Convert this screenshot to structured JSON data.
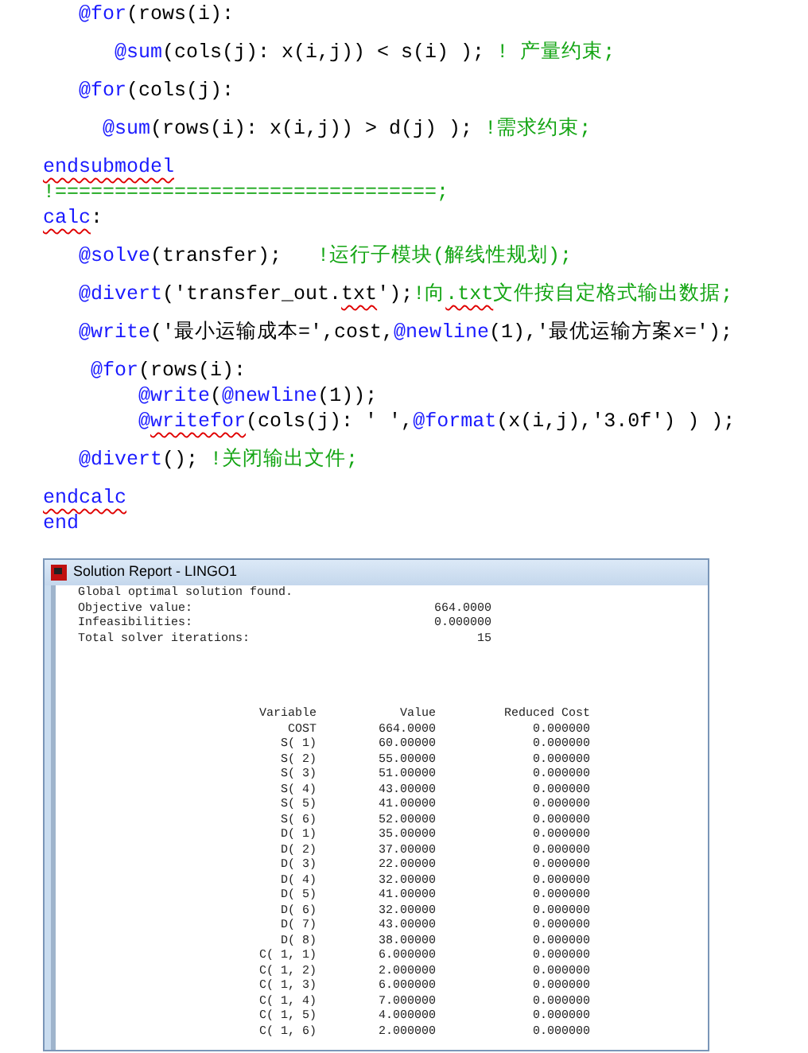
{
  "code_blocks": [
    [
      {
        "segments": [
          {
            "kind": "func",
            "text": "   @for",
            "misspelled": false
          },
          {
            "kind": "plain",
            "text": "(rows(i):",
            "misspelled": false
          }
        ]
      }
    ],
    [
      {
        "segments": [
          {
            "kind": "func",
            "text": "      @sum",
            "misspelled": false
          },
          {
            "kind": "plain",
            "text": "(cols(j): x(i,j)) < s(i) ); ",
            "misspelled": false
          },
          {
            "kind": "comment",
            "text": "! 产量约束;",
            "misspelled": false
          }
        ]
      }
    ],
    [
      {
        "segments": [
          {
            "kind": "func",
            "text": "   @for",
            "misspelled": false
          },
          {
            "kind": "plain",
            "text": "(cols(j):",
            "misspelled": false
          }
        ]
      }
    ],
    [
      {
        "segments": [
          {
            "kind": "func",
            "text": "     @sum",
            "misspelled": false
          },
          {
            "kind": "plain",
            "text": "(rows(i): x(i,j)) > d(j) ); ",
            "misspelled": false
          },
          {
            "kind": "comment",
            "text": "!需求约束;",
            "misspelled": false
          }
        ]
      }
    ],
    [
      {
        "segments": [
          {
            "kind": "func",
            "text": "endsubmodel",
            "misspelled": true
          }
        ]
      },
      {
        "segments": [
          {
            "kind": "comment",
            "text": "!================================;",
            "misspelled": false
          }
        ]
      },
      {
        "segments": [
          {
            "kind": "func",
            "text": "calc",
            "misspelled": true
          },
          {
            "kind": "plain",
            "text": ":",
            "misspelled": false
          }
        ]
      }
    ],
    [
      {
        "segments": [
          {
            "kind": "func",
            "text": "   @solve",
            "misspelled": false
          },
          {
            "kind": "plain",
            "text": "(transfer);   ",
            "misspelled": false
          },
          {
            "kind": "comment",
            "text": "!运行子模块(解线性规划);",
            "misspelled": false
          }
        ]
      }
    ],
    [
      {
        "segments": [
          {
            "kind": "func",
            "text": "   @divert",
            "misspelled": false
          },
          {
            "kind": "plain",
            "text": "('transfer_out.",
            "misspelled": false
          },
          {
            "kind": "plain",
            "text": "txt",
            "misspelled": true
          },
          {
            "kind": "plain",
            "text": "');",
            "misspelled": false
          },
          {
            "kind": "comment",
            "text": "!向",
            "misspelled": false
          },
          {
            "kind": "comment",
            "text": ".txt",
            "misspelled": true
          },
          {
            "kind": "comment",
            "text": "文件按自定格式输出数据;",
            "misspelled": false
          }
        ]
      }
    ],
    [
      {
        "segments": [
          {
            "kind": "func",
            "text": "   @write",
            "misspelled": false
          },
          {
            "kind": "plain",
            "text": "('最小运输成本=',cost,",
            "misspelled": false
          },
          {
            "kind": "func",
            "text": "@newline",
            "misspelled": false
          },
          {
            "kind": "plain",
            "text": "(1),'最优运输方案x=');",
            "misspelled": false
          }
        ]
      }
    ],
    [
      {
        "segments": [
          {
            "kind": "func",
            "text": "    @for",
            "misspelled": false
          },
          {
            "kind": "plain",
            "text": "(rows(i):",
            "misspelled": false
          }
        ]
      },
      {
        "segments": [
          {
            "kind": "func",
            "text": "        @write",
            "misspelled": false
          },
          {
            "kind": "plain",
            "text": "(",
            "misspelled": false
          },
          {
            "kind": "func",
            "text": "@newline",
            "misspelled": false
          },
          {
            "kind": "plain",
            "text": "(1));",
            "misspelled": false
          }
        ]
      },
      {
        "segments": [
          {
            "kind": "func",
            "text": "        @",
            "misspelled": false
          },
          {
            "kind": "func",
            "text": "writefor",
            "misspelled": true
          },
          {
            "kind": "plain",
            "text": "(cols(j): ' ',",
            "misspelled": false
          },
          {
            "kind": "func",
            "text": "@format",
            "misspelled": false
          },
          {
            "kind": "plain",
            "text": "(x(i,j),'3.0f') ) );",
            "misspelled": false
          }
        ]
      }
    ],
    [
      {
        "segments": [
          {
            "kind": "func",
            "text": "   @divert",
            "misspelled": false
          },
          {
            "kind": "plain",
            "text": "(); ",
            "misspelled": false
          },
          {
            "kind": "comment",
            "text": "!关闭输出文件;",
            "misspelled": false
          }
        ]
      }
    ],
    [
      {
        "segments": [
          {
            "kind": "func",
            "text": "endcalc",
            "misspelled": true
          }
        ]
      },
      {
        "segments": [
          {
            "kind": "func",
            "text": "end",
            "misspelled": false
          }
        ]
      }
    ]
  ],
  "report_window": {
    "title": "Solution Report - LINGO1",
    "summary": [
      {
        "label": "Global optimal solution found."
      },
      {
        "label": "Objective value:",
        "value": "664.0000"
      },
      {
        "label": "Infeasibilities:",
        "value": "0.000000"
      },
      {
        "label": "Total solver iterations:",
        "value": "15"
      }
    ],
    "table": {
      "columns": [
        "Variable",
        "Value",
        "Reduced Cost"
      ],
      "rows": [
        [
          "COST",
          "664.0000",
          "0.000000"
        ],
        [
          "S( 1)",
          "60.00000",
          "0.000000"
        ],
        [
          "S( 2)",
          "55.00000",
          "0.000000"
        ],
        [
          "S( 3)",
          "51.00000",
          "0.000000"
        ],
        [
          "S( 4)",
          "43.00000",
          "0.000000"
        ],
        [
          "S( 5)",
          "41.00000",
          "0.000000"
        ],
        [
          "S( 6)",
          "52.00000",
          "0.000000"
        ],
        [
          "D( 1)",
          "35.00000",
          "0.000000"
        ],
        [
          "D( 2)",
          "37.00000",
          "0.000000"
        ],
        [
          "D( 3)",
          "22.00000",
          "0.000000"
        ],
        [
          "D( 4)",
          "32.00000",
          "0.000000"
        ],
        [
          "D( 5)",
          "41.00000",
          "0.000000"
        ],
        [
          "D( 6)",
          "32.00000",
          "0.000000"
        ],
        [
          "D( 7)",
          "43.00000",
          "0.000000"
        ],
        [
          "D( 8)",
          "38.00000",
          "0.000000"
        ],
        [
          "C( 1, 1)",
          "6.000000",
          "0.000000"
        ],
        [
          "C( 1, 2)",
          "2.000000",
          "0.000000"
        ],
        [
          "C( 1, 3)",
          "6.000000",
          "0.000000"
        ],
        [
          "C( 1, 4)",
          "7.000000",
          "0.000000"
        ],
        [
          "C( 1, 5)",
          "4.000000",
          "0.000000"
        ],
        [
          "C( 1, 6)",
          "2.000000",
          "0.000000"
        ]
      ]
    }
  }
}
